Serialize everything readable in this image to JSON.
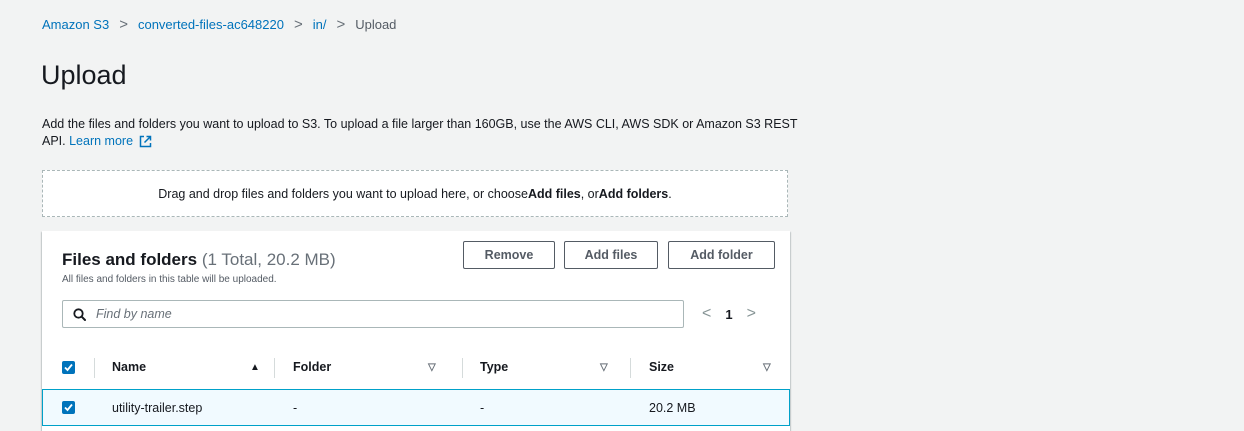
{
  "breadcrumb": {
    "items": [
      "Amazon S3",
      "converted-files-ac648220",
      "in/"
    ],
    "current": "Upload"
  },
  "page_title": "Upload",
  "description": {
    "text": "Add the files and folders you want to upload to S3. To upload a file larger than 160GB, use the AWS CLI, AWS SDK or Amazon S3 REST API.",
    "learn_more": "Learn more"
  },
  "dropzone": {
    "prefix": "Drag and drop files and folders you want to upload here, or choose ",
    "add_files": "Add files",
    "middle": ", or ",
    "add_folders": "Add folders",
    "suffix": "."
  },
  "files_panel": {
    "title": "Files and folders",
    "count": "(1 Total, 20.2 MB)",
    "subtitle": "All files and folders in this table will be uploaded.",
    "buttons": {
      "remove": "Remove",
      "add_files": "Add files",
      "add_folder": "Add folder"
    },
    "search": {
      "placeholder": "Find by name",
      "value": ""
    },
    "pagination": {
      "page": "1"
    },
    "columns": [
      "Name",
      "Folder",
      "Type",
      "Size"
    ],
    "rows": [
      {
        "name": "utility-trailer.step",
        "folder": "-",
        "type": "-",
        "size": "20.2 MB",
        "selected": true
      }
    ]
  },
  "icons": {
    "external": "external-link-icon",
    "search": "search-icon",
    "checkbox": "checkbox-checked-icon",
    "sort_asc": "sort-ascending-icon",
    "sort": "sort-icon"
  },
  "colors": {
    "link": "#0073bb",
    "background": "#f2f3f3",
    "selected_row": "#f1faff",
    "selected_border": "#00a1c9"
  }
}
